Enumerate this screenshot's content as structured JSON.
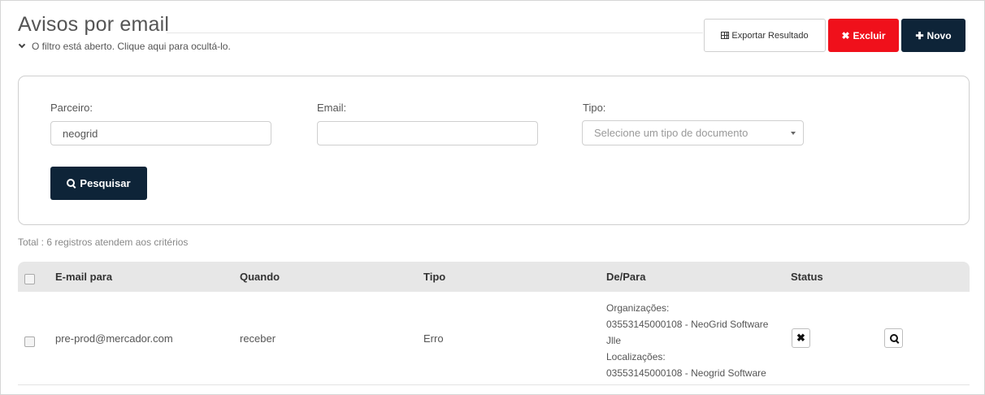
{
  "header": {
    "title": "Avisos por email",
    "filter_toggle": "O filtro está aberto. Clique aqui para ocultá-lo."
  },
  "toolbar": {
    "export_label": "Exportar Resultado",
    "delete_label": "Excluir",
    "new_label": "Novo"
  },
  "filters": {
    "partner": {
      "label": "Parceiro:",
      "value": "neogrid"
    },
    "email": {
      "label": "Email:",
      "value": ""
    },
    "type": {
      "label": "Tipo:",
      "placeholder": "Selecione um tipo de documento"
    },
    "search_label": "Pesquisar"
  },
  "results": {
    "total": "Total : 6  registros atendem aos critérios"
  },
  "table": {
    "columns": [
      "E-mail para",
      "Quando",
      "Tipo",
      "De/Para",
      "Status"
    ],
    "rows": [
      {
        "email": "pre-prod@mercador.com",
        "when": "receber",
        "type": "Erro",
        "depara_lines": [
          "Organizações:",
          "03553145000108 - NeoGrid Software",
          "Jlle",
          "Localizações:",
          "03553145000108 - Neogrid Software"
        ]
      }
    ]
  },
  "colors": {
    "primary": "#0e2438",
    "danger": "#f0101b",
    "header_bg": "#e7e7e7"
  },
  "icons": {
    "filter_toggle": "chevron-down-icon",
    "export": "table-icon",
    "delete": "times-icon",
    "new": "plus-icon",
    "search": "search-icon",
    "status": "times-icon",
    "details": "search-icon"
  }
}
